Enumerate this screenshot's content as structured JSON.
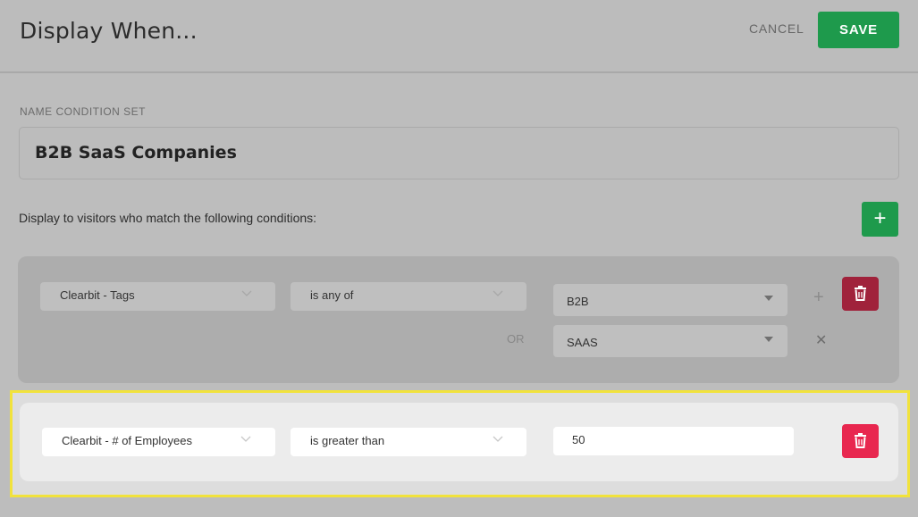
{
  "header": {
    "title": "Display When...",
    "cancel_label": "CANCEL",
    "save_label": "SAVE"
  },
  "name_set": {
    "label": "NAME CONDITION SET",
    "value": "B2B SaaS Companies"
  },
  "instructions": "Display to visitors who match the following conditions:",
  "add_icon": "+",
  "conditions": [
    {
      "attribute": "Clearbit - Tags",
      "operator": "is any of",
      "values": [
        "B2B",
        "SAAS"
      ],
      "or_label": "OR",
      "add_value_icon": "+",
      "remove_value_icon": "✕"
    },
    {
      "attribute": "Clearbit - # of Employees",
      "operator": "is greater than",
      "value": "50"
    }
  ],
  "colors": {
    "accent_green": "#1e9a4c",
    "delete_red": "#e8274f",
    "delete_red_dimmed": "#a0223b",
    "highlight": "#f1e23c"
  }
}
